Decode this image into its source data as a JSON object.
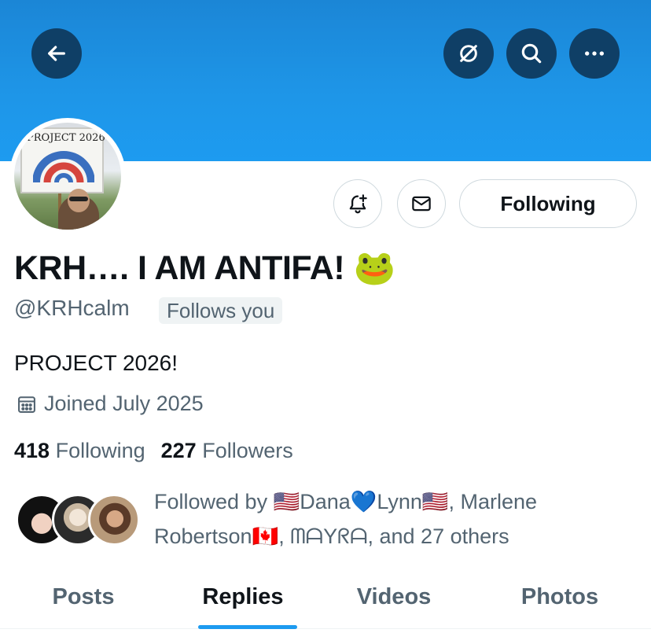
{
  "header": {
    "back_icon": "arrow-left-icon",
    "translate_icon": "grok-slash-icon",
    "search_icon": "search-icon",
    "more_icon": "more-horizontal-icon"
  },
  "profile": {
    "avatar_sign_text": "PROJECT 2026",
    "display_name": "KRH…. I AM ANTIFA! 🐸",
    "handle": "@KRHcalm",
    "follows_you": "Follows you",
    "bio": "PROJECT 2026!",
    "joined": "Joined July 2025",
    "following_count": "418",
    "following_label": "Following",
    "followers_count": "227",
    "followers_label": "Followers",
    "followed_by": "Followed by 🇺🇸Dana💙Lynn🇺🇸, Marlene Robertson🇨🇦, ᗰᗩYᖇᗩ, and 27 others"
  },
  "actions": {
    "notify_icon": "bell-plus-icon",
    "message_icon": "envelope-icon",
    "following_button": "Following"
  },
  "tabs": [
    {
      "label": "Posts",
      "active": false
    },
    {
      "label": "Replies",
      "active": true
    },
    {
      "label": "Videos",
      "active": false
    },
    {
      "label": "Photos",
      "active": false
    }
  ],
  "colors": {
    "accent": "#1d9bf0",
    "banner": "#1d9bf0",
    "header_button": "#0f3f66",
    "secondary_text": "#536471"
  }
}
